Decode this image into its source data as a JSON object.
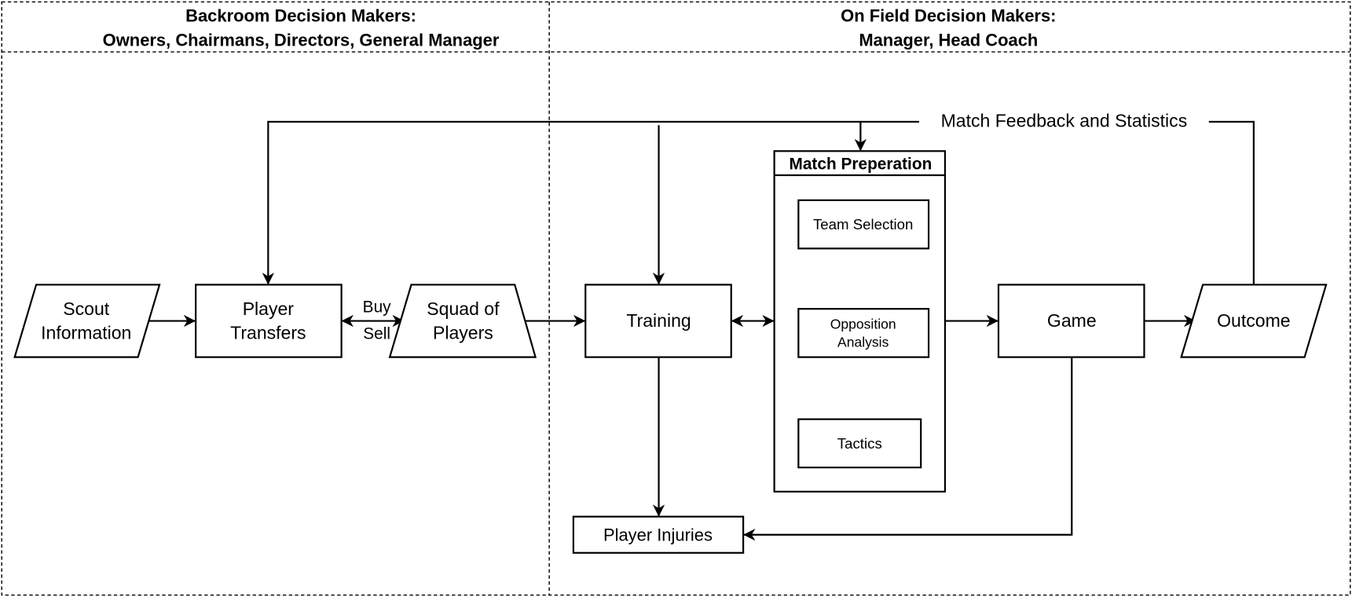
{
  "lanes": {
    "backroom": {
      "title": "Backroom Decision Makers:",
      "subtitle": "Owners, Chairmans, Directors, General Manager"
    },
    "onfield": {
      "title": "On Field Decision Makers:",
      "subtitle": "Manager, Head Coach"
    }
  },
  "nodes": {
    "scout": {
      "line1": "Scout",
      "line2": "Information"
    },
    "transfers": {
      "line1": "Player",
      "line2": "Transfers"
    },
    "squad": {
      "line1": "Squad of",
      "line2": "Players"
    },
    "training": "Training",
    "match_prep": {
      "title": "Match Preperation",
      "team_selection": "Team Selection",
      "opposition": {
        "line1": "Opposition",
        "line2": "Analysis"
      },
      "tactics": "Tactics"
    },
    "game": "Game",
    "outcome": "Outcome",
    "injuries": "Player Injuries"
  },
  "edge_labels": {
    "buy": "Buy",
    "sell": "Sell",
    "feedback": "Match Feedback and Statistics"
  }
}
